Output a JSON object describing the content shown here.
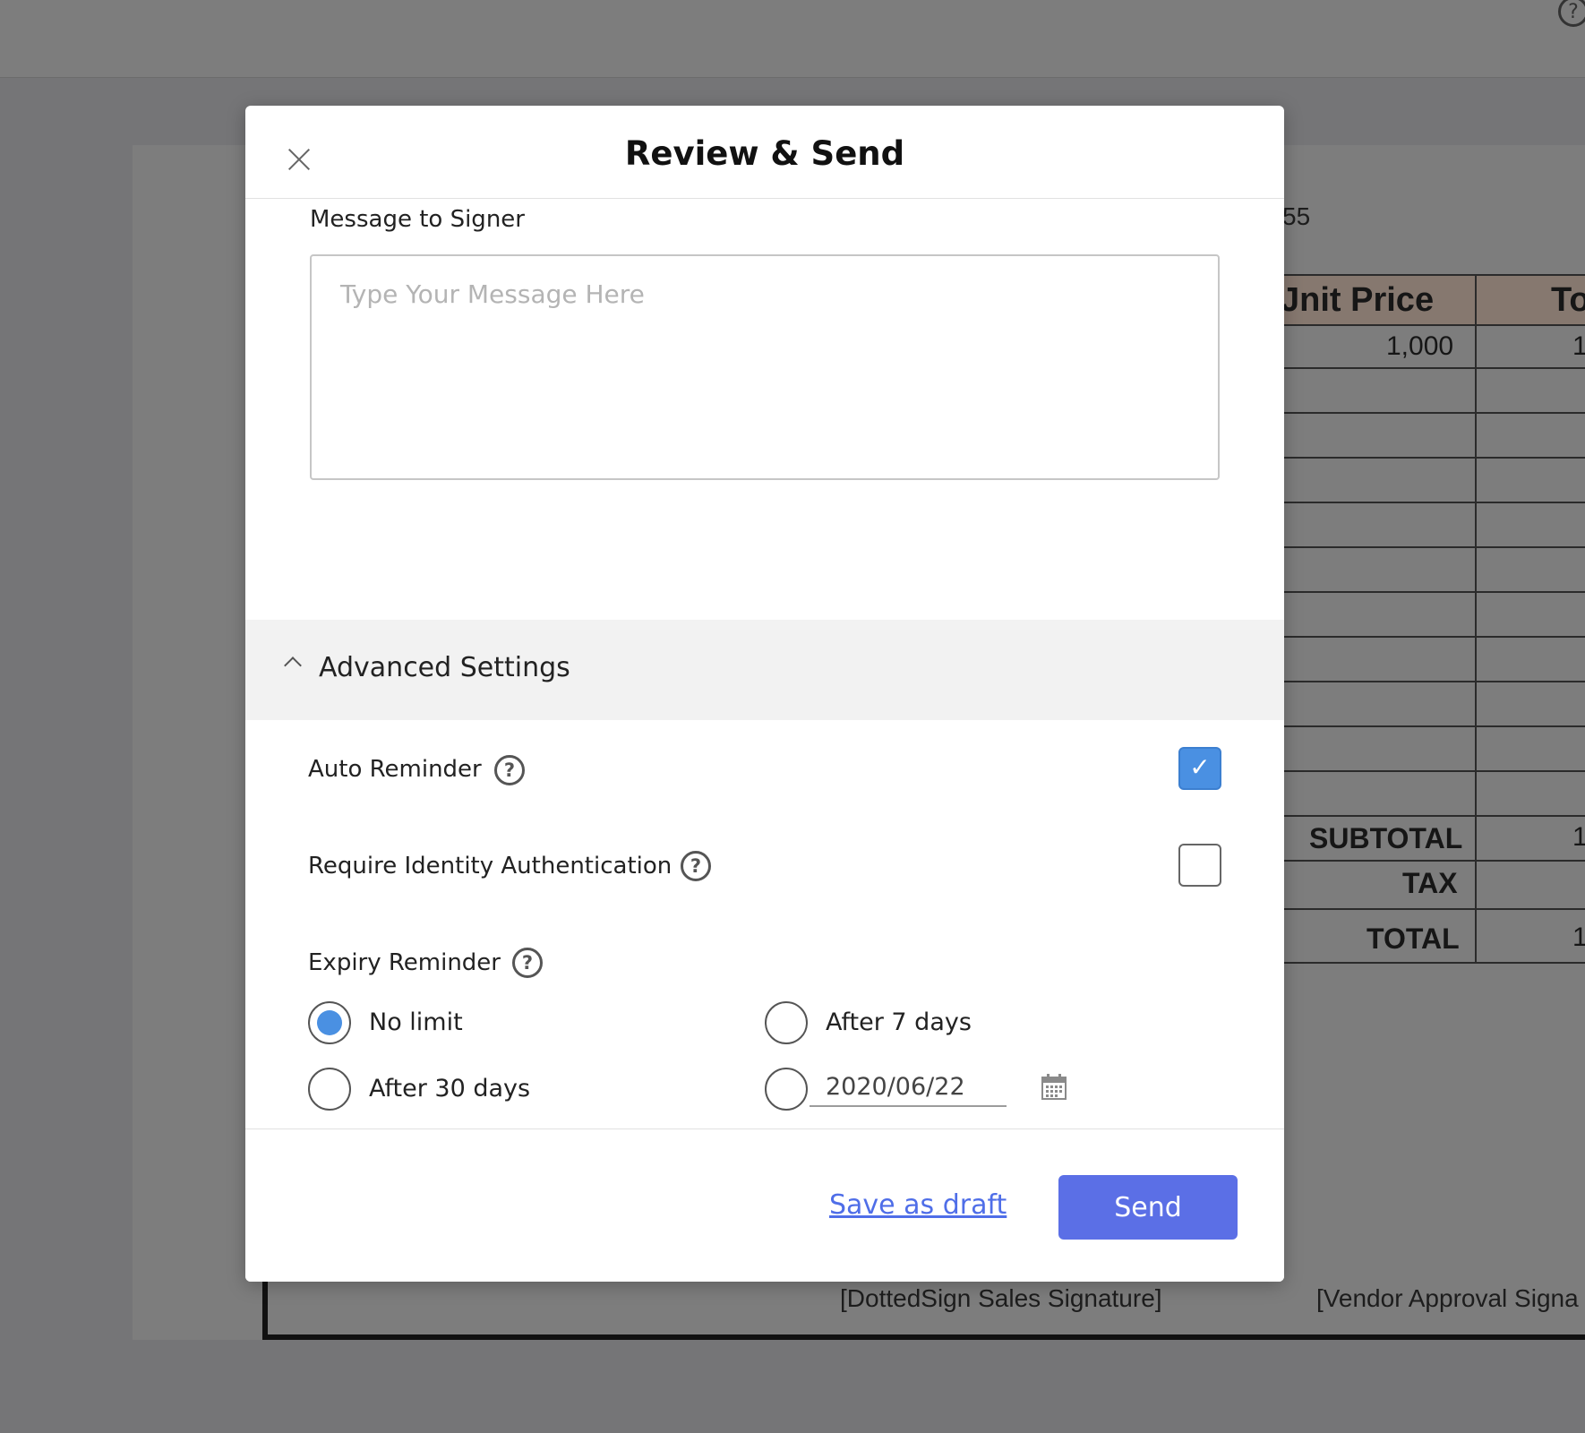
{
  "app": {
    "help_icon": "?",
    "document": {
      "number_fragment": "55",
      "table_headers": [
        "Jnit Price",
        "To"
      ],
      "rows": [
        {
          "unit_price": "1,000",
          "total": "1"
        }
      ],
      "summary": [
        {
          "label": "SUBTOTAL",
          "value": "1"
        },
        {
          "label": "TAX",
          "value": ""
        },
        {
          "label": "TOTAL",
          "value": "1"
        }
      ],
      "signatures": [
        "[DottedSign Sales Signature]",
        "[Vendor Approval Signa"
      ]
    }
  },
  "modal": {
    "title": "Review & Send",
    "message": {
      "label": "Message to Signer",
      "placeholder": "Type Your Message Here",
      "value": ""
    },
    "advanced": {
      "label": "Advanced Settings",
      "expanded": true,
      "auto_reminder": {
        "label": "Auto Reminder",
        "checked": true,
        "check_glyph": "✓"
      },
      "identity_auth": {
        "label": "Require Identity Authentication",
        "checked": false
      },
      "expiry": {
        "label": "Expiry Reminder",
        "options": [
          {
            "label": "No limit",
            "selected": true
          },
          {
            "label": "After 7 days",
            "selected": false
          },
          {
            "label": "After 30 days",
            "selected": false
          },
          {
            "label": "custom-date",
            "selected": false
          }
        ],
        "date_value": "2020/06/22"
      },
      "help_glyph": "?"
    },
    "footer": {
      "draft_label": "Save as draft",
      "send_label": "Send"
    }
  },
  "colors": {
    "accent": "#4a90e2",
    "send_button": "#5b6fe6",
    "draft_link": "#4f6ee8",
    "overlay": "#757577"
  }
}
